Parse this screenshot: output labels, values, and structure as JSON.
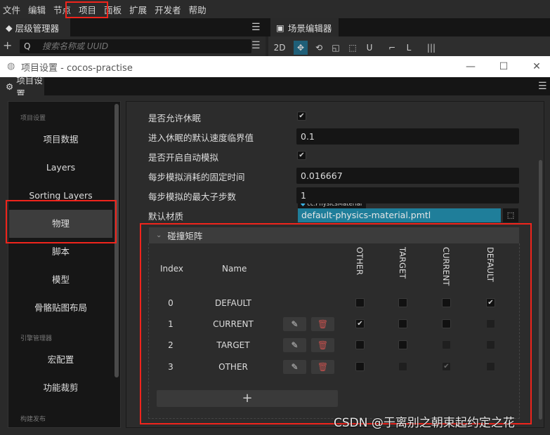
{
  "menubar": {
    "items": [
      "文件",
      "编辑",
      "节点",
      "项目",
      "面板",
      "扩展",
      "开发者",
      "帮助"
    ]
  },
  "panels": {
    "hierarchy_tab": "层级管理器",
    "scene_tab": "场景编辑器",
    "search_placeholder": "搜索名称或 UUID",
    "scene_tools": [
      "2D",
      "✥",
      "⟲",
      "◱",
      "⬚",
      "U",
      "⌐",
      "L",
      "|||"
    ]
  },
  "dialog": {
    "title": "项目设置 - cocos-practise",
    "tab": "项目设置",
    "controls": {
      "minimize": "—",
      "maximize": "☐",
      "close": "✕"
    }
  },
  "sidebar": {
    "group1": "项目设置",
    "items1": [
      "项目数据",
      "Layers",
      "Sorting Layers",
      "物理",
      "脚本",
      "模型",
      "骨骼贴图布局"
    ],
    "active": "物理",
    "group2": "引擎管理器",
    "items2": [
      "宏配置",
      "功能裁剪"
    ],
    "group3": "构建发布"
  },
  "physics": {
    "rows": [
      {
        "label": "是否允许休眠",
        "type": "checkbox",
        "checked": true
      },
      {
        "label": "进入休眠的默认速度临界值",
        "type": "input",
        "value": "0.1"
      },
      {
        "label": "是否开启自动模拟",
        "type": "checkbox",
        "checked": true
      },
      {
        "label": "每步模拟消耗的固定时间",
        "type": "input",
        "value": "0.016667"
      },
      {
        "label": "每步模拟的最大子步数",
        "type": "input",
        "value": "1"
      }
    ],
    "material_label": "默认材质",
    "material_type": "cc.PhysicsMaterial",
    "material_value": "default-physics-material.pmtl",
    "accent": "#1f7e9a"
  },
  "collision": {
    "title": "碰撞矩阵",
    "index_header": "Index",
    "name_header": "Name",
    "columns": [
      "OTHER",
      "TARGET",
      "CURRENT",
      "DEFAULT"
    ],
    "groups": [
      {
        "index": "0",
        "name": "DEFAULT",
        "editable": false,
        "cells": [
          {
            "c": false,
            "d": false
          },
          {
            "c": false,
            "d": false
          },
          {
            "c": false,
            "d": false
          },
          {
            "c": true,
            "d": false
          }
        ]
      },
      {
        "index": "1",
        "name": "CURRENT",
        "editable": true,
        "cells": [
          {
            "c": true,
            "d": false
          },
          {
            "c": false,
            "d": false
          },
          {
            "c": false,
            "d": false
          },
          {
            "c": false,
            "d": true
          }
        ]
      },
      {
        "index": "2",
        "name": "TARGET",
        "editable": true,
        "cells": [
          {
            "c": false,
            "d": false
          },
          {
            "c": false,
            "d": false
          },
          {
            "c": false,
            "d": true
          },
          {
            "c": false,
            "d": true
          }
        ]
      },
      {
        "index": "3",
        "name": "OTHER",
        "editable": true,
        "cells": [
          {
            "c": false,
            "d": false
          },
          {
            "c": false,
            "d": true
          },
          {
            "c": true,
            "d": true
          },
          {
            "c": false,
            "d": true
          }
        ]
      }
    ],
    "add_label": "+"
  },
  "watermark": "CSDN @于离别之朝束起约定之花"
}
